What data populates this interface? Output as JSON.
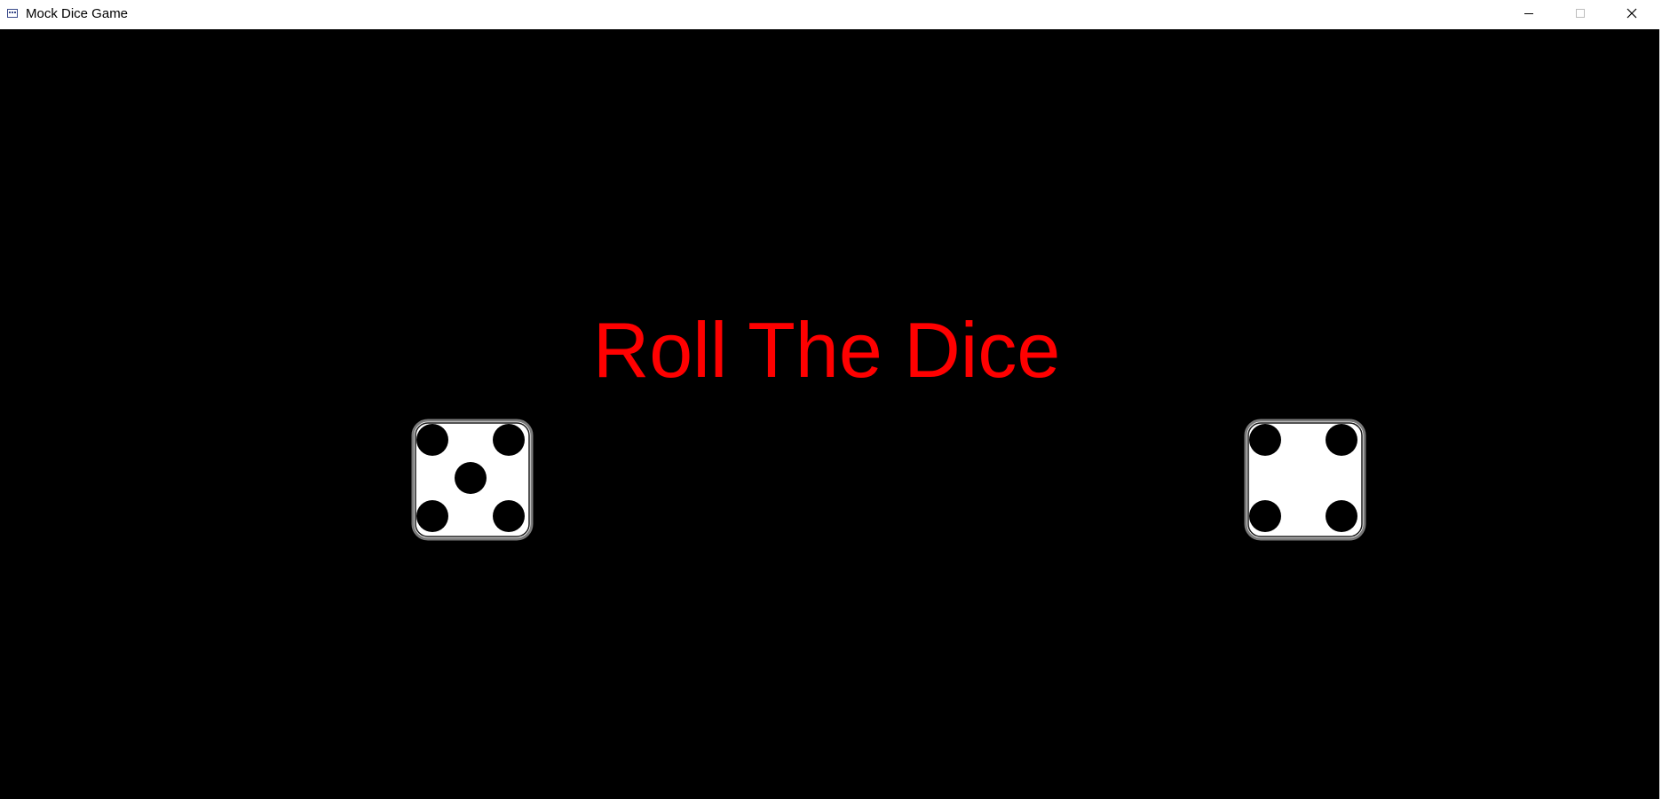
{
  "window": {
    "title": "Mock Dice Game",
    "controls": [
      "minimize",
      "maximize",
      "close"
    ]
  },
  "game": {
    "heading": "Roll The Dice",
    "heading_color": "#ff0000",
    "background_color": "#000000",
    "dice": [
      {
        "name": "die-left",
        "value": 5
      },
      {
        "name": "die-right",
        "value": 4
      }
    ]
  }
}
